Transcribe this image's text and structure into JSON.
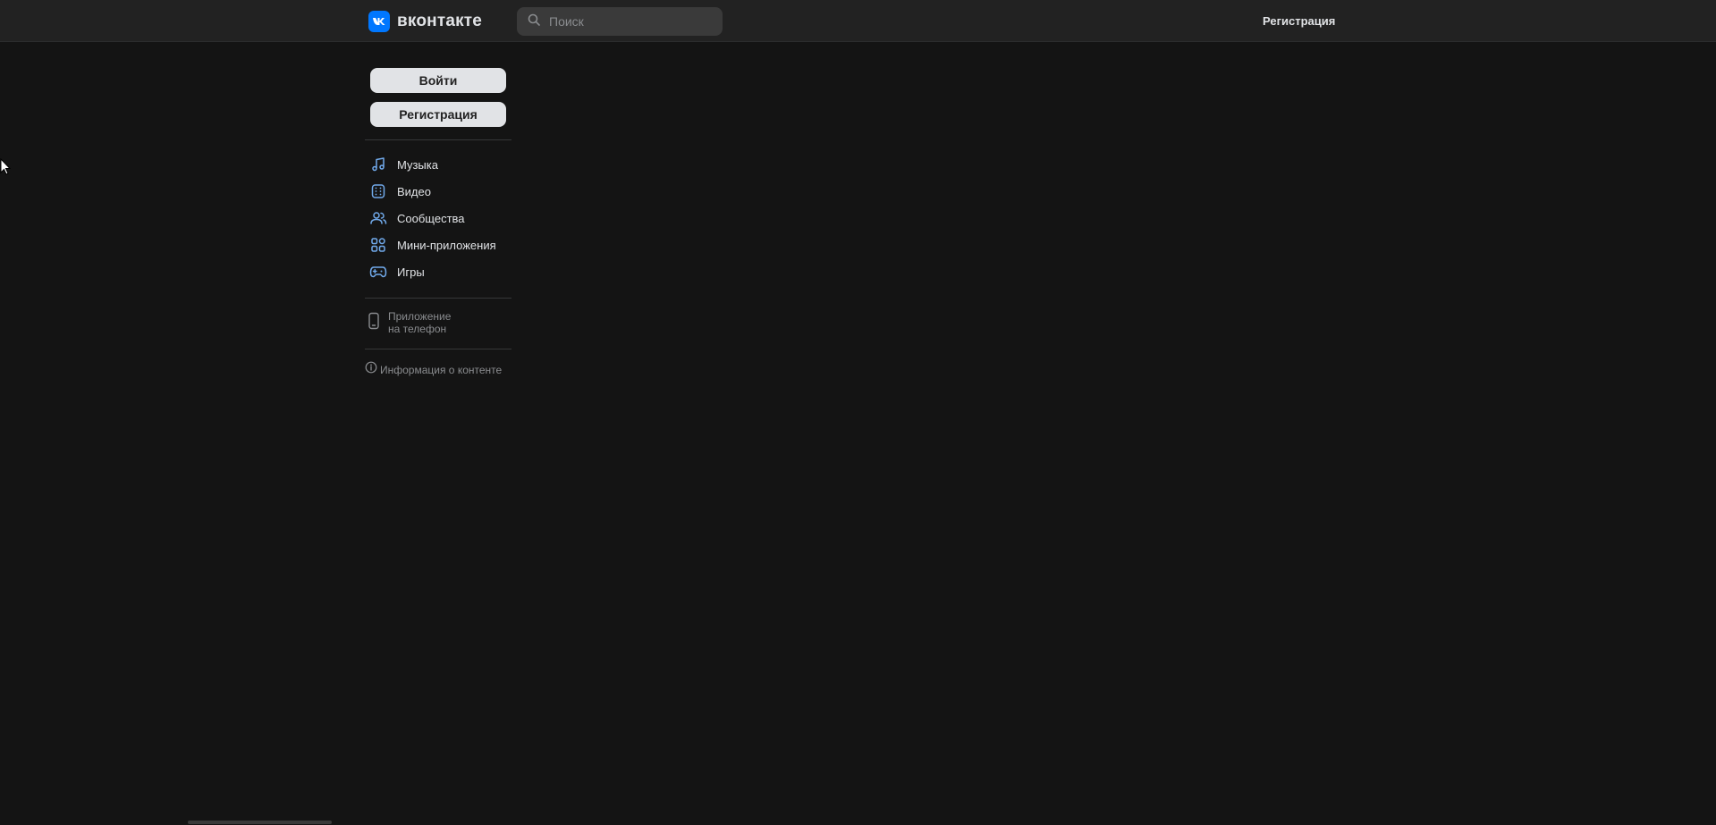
{
  "header": {
    "logo_text": "вконтакте",
    "search_placeholder": "Поиск",
    "register_link": "Регистрация"
  },
  "sidebar": {
    "login_button": "Войти",
    "register_button": "Регистрация",
    "nav_items": [
      {
        "label": "Музыка",
        "icon": "music-icon"
      },
      {
        "label": "Видео",
        "icon": "video-icon"
      },
      {
        "label": "Сообщества",
        "icon": "communities-icon"
      },
      {
        "label": "Мини-приложения",
        "icon": "mini-apps-icon"
      },
      {
        "label": "Игры",
        "icon": "gamepad-icon"
      }
    ],
    "app_link_line1": "Приложение",
    "app_link_line2": "на телефон",
    "info_link": "Информация о контенте"
  },
  "colors": {
    "background": "#141414",
    "header": "#222222",
    "accent": "#0077ff",
    "icon_accent": "#71aaeb",
    "button_bg": "#e1e3e6"
  }
}
